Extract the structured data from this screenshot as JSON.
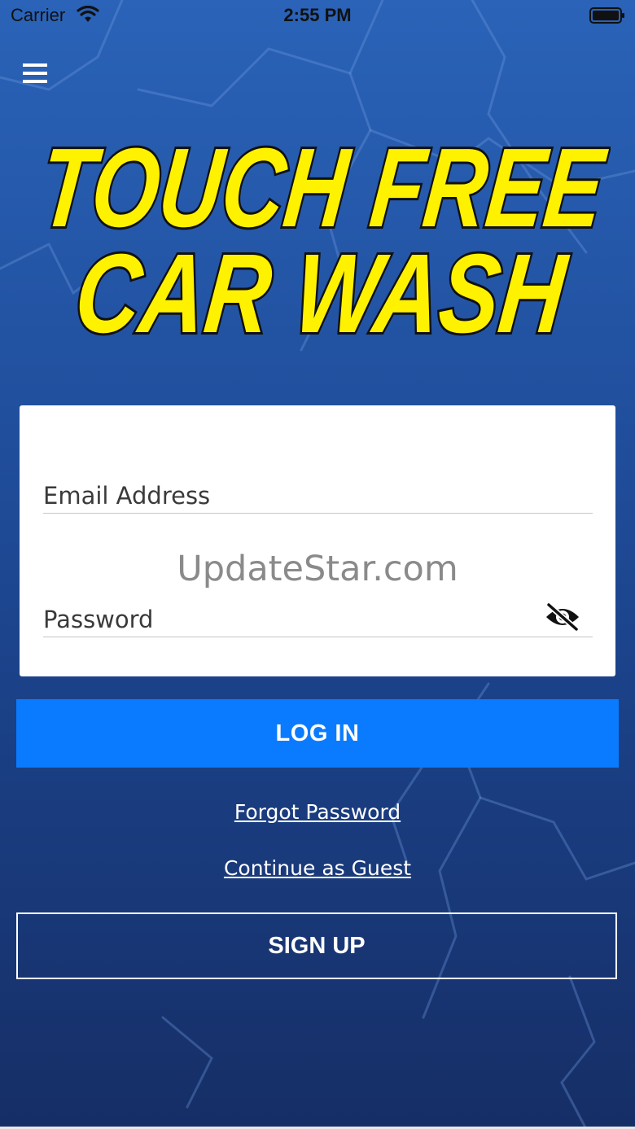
{
  "status_bar": {
    "carrier": "Carrier",
    "time": "2:55 PM"
  },
  "logo": {
    "line1": "TOUCH FREE",
    "line2": "CAR WASH",
    "fill_color": "#fff200",
    "outline_color": "#111111"
  },
  "form": {
    "email_label": "Email Address",
    "password_label": "Password",
    "password_toggle_icon": "eye-slash-icon"
  },
  "watermark": "UpdateStar.com",
  "buttons": {
    "login_label": "LOG IN",
    "signup_label": "SIGN UP"
  },
  "links": {
    "forgot_password": "Forgot Password",
    "continue_guest": "Continue as Guest"
  },
  "icons": {
    "menu": "hamburger-menu-icon",
    "wifi": "wifi-icon",
    "battery": "battery-icon"
  },
  "colors": {
    "background_top": "#2a63b8",
    "background_bottom": "#162e66",
    "primary_button": "#0a7bff",
    "card": "#ffffff"
  }
}
